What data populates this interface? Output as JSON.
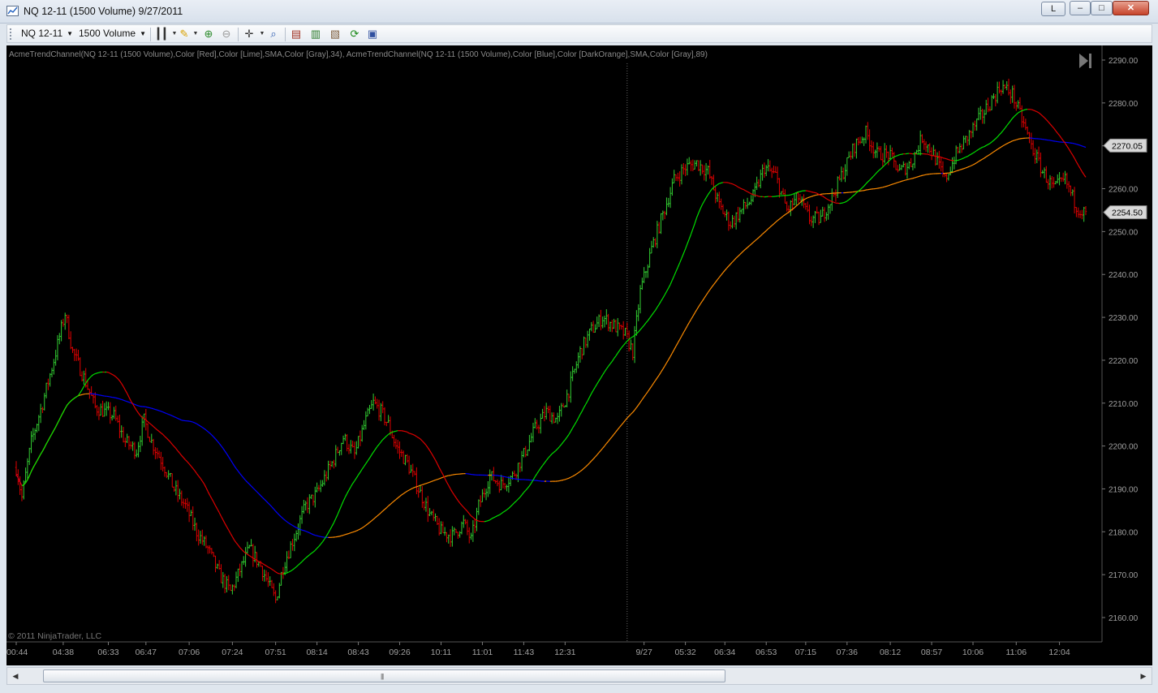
{
  "window": {
    "title": "NQ 12-11 (1500 Volume)  9/27/2011",
    "btn_l": "L",
    "btn_min": "–",
    "btn_max": "□",
    "btn_close": "✕"
  },
  "toolbar": {
    "instrument": "NQ 12-11",
    "period": "1500 Volume"
  },
  "chart": {
    "indicator_label": "AcmeTrendChannel(NQ 12-11 (1500 Volume),Color [Red],Color [Lime],SMA,Color [Gray],34), AcmeTrendChannel(NQ 12-11 (1500 Volume),Color [Blue],Color [DarkOrange],SMA,Color [Gray],89)",
    "copyright": "© 2011 NinjaTrader, LLC",
    "colors": {
      "background": "#000000",
      "up_bar": "#32cd32",
      "down_bar": "#e00000",
      "fast_trend_up": "#00e000",
      "fast_trend_down": "#e00000",
      "slow_trend_up": "#ff8c00",
      "slow_trend_down": "#0000ff",
      "axis_text": "#a0a0a0"
    },
    "price_flags": [
      {
        "label": "2270.05",
        "value": 2270.05
      },
      {
        "label": "2254.50",
        "value": 2254.5
      }
    ]
  },
  "chart_data": {
    "type": "bar",
    "ylim": [
      2157,
      2293
    ],
    "y_ticks": [
      "2290.00",
      "2280.00",
      "2270.00",
      "2260.00",
      "2250.00",
      "2240.00",
      "2230.00",
      "2220.00",
      "2210.00",
      "2200.00",
      "2190.00",
      "2180.00",
      "2170.00",
      "2160.00"
    ],
    "y_tick_values": [
      2290,
      2280,
      2270,
      2260,
      2250,
      2240,
      2230,
      2220,
      2210,
      2200,
      2190,
      2180,
      2170,
      2160
    ],
    "x_ticks": [
      "00:44",
      "04:38",
      "06:33",
      "06:47",
      "07:06",
      "07:24",
      "07:51",
      "08:14",
      "08:43",
      "09:26",
      "10:11",
      "11:01",
      "11:43",
      "12:31",
      "9/27",
      "05:32",
      "06:34",
      "06:53",
      "07:15",
      "07:36",
      "08:12",
      "08:57",
      "10:06",
      "11:06",
      "12:04"
    ],
    "x_tick_index": [
      0,
      25,
      49,
      69,
      92,
      115,
      138,
      160,
      182,
      204,
      226,
      248,
      270,
      292,
      334,
      356,
      377,
      399,
      420,
      442,
      465,
      487,
      509,
      532,
      555
    ],
    "session_break_index": 325,
    "bar_count": 570,
    "anchors": [
      [
        0,
        2195
      ],
      [
        3,
        2188
      ],
      [
        8,
        2201
      ],
      [
        14,
        2210
      ],
      [
        20,
        2220
      ],
      [
        26,
        2231
      ],
      [
        30,
        2222
      ],
      [
        36,
        2216
      ],
      [
        42,
        2209
      ],
      [
        52,
        2207
      ],
      [
        58,
        2201
      ],
      [
        64,
        2199
      ],
      [
        68,
        2206
      ],
      [
        72,
        2201
      ],
      [
        78,
        2196
      ],
      [
        84,
        2190
      ],
      [
        90,
        2186
      ],
      [
        96,
        2180
      ],
      [
        102,
        2176
      ],
      [
        108,
        2170
      ],
      [
        114,
        2166
      ],
      [
        118,
        2170
      ],
      [
        124,
        2176
      ],
      [
        130,
        2172
      ],
      [
        134,
        2168
      ],
      [
        138,
        2164
      ],
      [
        142,
        2172
      ],
      [
        148,
        2179
      ],
      [
        154,
        2186
      ],
      [
        160,
        2189
      ],
      [
        168,
        2196
      ],
      [
        174,
        2202
      ],
      [
        180,
        2198
      ],
      [
        186,
        2206
      ],
      [
        190,
        2210
      ],
      [
        194,
        2208
      ],
      [
        198,
        2205
      ],
      [
        202,
        2200
      ],
      [
        208,
        2196
      ],
      [
        214,
        2190
      ],
      [
        220,
        2184
      ],
      [
        226,
        2180
      ],
      [
        232,
        2179
      ],
      [
        238,
        2182
      ],
      [
        242,
        2178
      ],
      [
        246,
        2186
      ],
      [
        252,
        2193
      ],
      [
        258,
        2191
      ],
      [
        264,
        2193
      ],
      [
        270,
        2198
      ],
      [
        276,
        2204
      ],
      [
        282,
        2208
      ],
      [
        288,
        2206
      ],
      [
        294,
        2213
      ],
      [
        300,
        2222
      ],
      [
        306,
        2227
      ],
      [
        312,
        2230
      ],
      [
        318,
        2228
      ],
      [
        324,
        2226
      ],
      [
        328,
        2222
      ],
      [
        332,
        2236
      ],
      [
        338,
        2246
      ],
      [
        344,
        2254
      ],
      [
        350,
        2262
      ],
      [
        356,
        2265
      ],
      [
        362,
        2266
      ],
      [
        368,
        2264
      ],
      [
        374,
        2256
      ],
      [
        380,
        2252
      ],
      [
        386,
        2255
      ],
      [
        392,
        2258
      ],
      [
        398,
        2265
      ],
      [
        404,
        2263
      ],
      [
        410,
        2255
      ],
      [
        416,
        2258
      ],
      [
        422,
        2253
      ],
      [
        428,
        2253
      ],
      [
        434,
        2258
      ],
      [
        440,
        2264
      ],
      [
        446,
        2270
      ],
      [
        452,
        2273
      ],
      [
        458,
        2268
      ],
      [
        464,
        2268
      ],
      [
        470,
        2264
      ],
      [
        476,
        2266
      ],
      [
        482,
        2272
      ],
      [
        488,
        2268
      ],
      [
        494,
        2262
      ],
      [
        500,
        2268
      ],
      [
        506,
        2272
      ],
      [
        512,
        2276
      ],
      [
        518,
        2280
      ],
      [
        524,
        2284
      ],
      [
        530,
        2282
      ],
      [
        536,
        2275
      ],
      [
        540,
        2270
      ],
      [
        546,
        2264
      ],
      [
        552,
        2260
      ],
      [
        558,
        2262
      ],
      [
        564,
        2256
      ],
      [
        569,
        2254
      ]
    ]
  }
}
